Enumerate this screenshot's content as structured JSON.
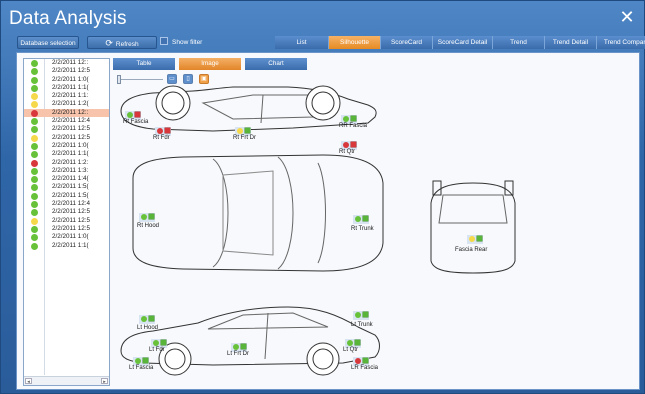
{
  "window": {
    "title": "Data Analysis",
    "close_glyph": "✕"
  },
  "toolbar": {
    "database_selection": "Database selection",
    "refresh": "Refresh",
    "refresh_icon": "refresh-icon",
    "show_filter": "Show filter"
  },
  "tabs": [
    {
      "label": "List",
      "active": false
    },
    {
      "label": "Silhouette",
      "active": true
    },
    {
      "label": "ScoreCard",
      "active": false
    },
    {
      "label": "ScoreCard Detail",
      "active": false
    },
    {
      "label": "Trend",
      "active": false
    },
    {
      "label": "Trend Detail",
      "active": false
    },
    {
      "label": "Trend Compare",
      "active": false
    }
  ],
  "view_tabs": [
    {
      "label": "Table",
      "active": false
    },
    {
      "label": "Image",
      "active": true
    },
    {
      "label": "Chart",
      "active": false
    }
  ],
  "records": [
    {
      "date": "2/2/2011 12::",
      "status": "green"
    },
    {
      "date": "2/2/2011 12:5",
      "status": "green"
    },
    {
      "date": "2/2/2011 1:0(",
      "status": "green"
    },
    {
      "date": "2/2/2011 1:1(",
      "status": "green"
    },
    {
      "date": "2/2/2011 1:1:",
      "status": "yellow"
    },
    {
      "date": "2/2/2011 1:2(",
      "status": "yellow"
    },
    {
      "date": "2/2/2011 12::",
      "status": "red",
      "selected": true
    },
    {
      "date": "2/2/2011 12:4",
      "status": "green"
    },
    {
      "date": "2/2/2011 12:5",
      "status": "green"
    },
    {
      "date": "2/2/2011 12:5",
      "status": "yellow"
    },
    {
      "date": "2/2/2011 1:0(",
      "status": "green"
    },
    {
      "date": "2/2/2011 1:1(",
      "status": "green"
    },
    {
      "date": "2/2/2011 1:2:",
      "status": "red"
    },
    {
      "date": "2/2/2011 1:3:",
      "status": "green"
    },
    {
      "date": "2/2/2011 1:4(",
      "status": "green"
    },
    {
      "date": "2/2/2011 1:5(",
      "status": "green"
    },
    {
      "date": "2/2/2011 1:5(",
      "status": "green"
    },
    {
      "date": "2/2/2011 12:4",
      "status": "green"
    },
    {
      "date": "2/2/2011 12:5",
      "status": "green"
    },
    {
      "date": "2/2/2011 12:5",
      "status": "yellow"
    },
    {
      "date": "2/2/2011 12:5",
      "status": "green"
    },
    {
      "date": "2/2/2011 1:0(",
      "status": "green"
    },
    {
      "date": "2/2/2011 1:1(",
      "status": "green"
    }
  ],
  "colors": {
    "green": "#67c23a",
    "yellow": "#f5d94a",
    "red": "#d8383c"
  },
  "measure_points": [
    {
      "label": "Rt Fascia"
    },
    {
      "label": "Rt Fdr"
    },
    {
      "label": "Rt Frt Dr"
    },
    {
      "label": "RR Fascia"
    },
    {
      "label": "Rt Qtr"
    },
    {
      "label": "Rt Hood"
    },
    {
      "label": "Lt Hood"
    },
    {
      "label": "Rt Trunk"
    },
    {
      "label": "Lt Trunk"
    },
    {
      "label": "Fascia Rear"
    },
    {
      "label": "Lt Fdr"
    },
    {
      "label": "Lt Frt Dr"
    },
    {
      "label": "Lt Qtr"
    },
    {
      "label": "Lt Fascia"
    },
    {
      "label": "LR Fascia"
    }
  ]
}
